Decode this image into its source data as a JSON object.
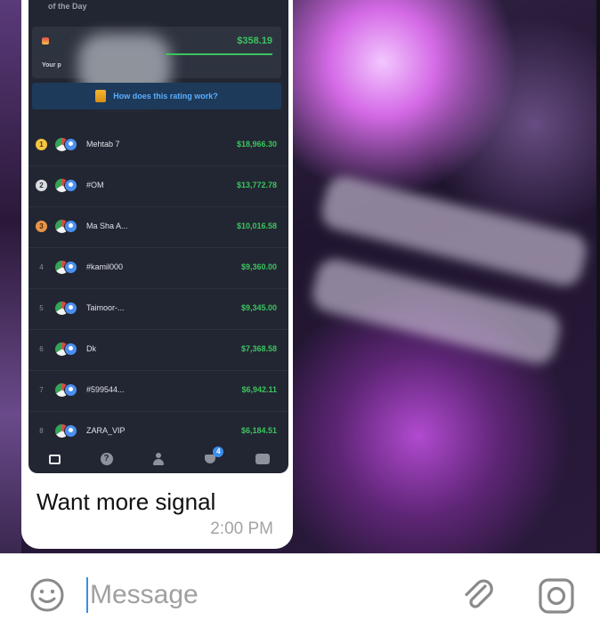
{
  "screenshot": {
    "header_label": "of the Day",
    "earnings": {
      "amount": "$358.19",
      "your_label": "Your p"
    },
    "rating_link": "How does this rating work?",
    "leaderboard": [
      {
        "rank": "1",
        "name": "Mehtab 7",
        "amount": "$18,966.30",
        "medal": "gold"
      },
      {
        "rank": "2",
        "name": "#OM",
        "amount": "$13,772.78",
        "medal": "silver"
      },
      {
        "rank": "3",
        "name": "Ma Sha A...",
        "amount": "$10,016.58",
        "medal": "bronze"
      },
      {
        "rank": "4",
        "name": "#kamil000",
        "amount": "$9,360.00",
        "medal": ""
      },
      {
        "rank": "5",
        "name": "Taimoor-...",
        "amount": "$9,345.00",
        "medal": ""
      },
      {
        "rank": "6",
        "name": "Dk",
        "amount": "$7,368.58",
        "medal": ""
      },
      {
        "rank": "7",
        "name": "#599544...",
        "amount": "$6,942.11",
        "medal": ""
      },
      {
        "rank": "8",
        "name": "ZARA_VIP",
        "amount": "$6,184.51",
        "medal": ""
      }
    ],
    "tabs": [
      {
        "icon": "gallery-icon"
      },
      {
        "icon": "help-icon",
        "glyph": "?"
      },
      {
        "icon": "person-icon"
      },
      {
        "icon": "trophy-icon",
        "badge": "4"
      },
      {
        "icon": "more-icon"
      }
    ]
  },
  "message": {
    "text": "Want more signal",
    "time": "2:00 PM"
  },
  "composer": {
    "placeholder": "Message",
    "emoji_icon": "emoji-icon",
    "attach_icon": "paperclip-icon",
    "camera_icon": "camera-icon"
  },
  "colors": {
    "accent": "#3a8ee6",
    "positive": "#3bc45e",
    "screenshot_bg": "#222632"
  }
}
